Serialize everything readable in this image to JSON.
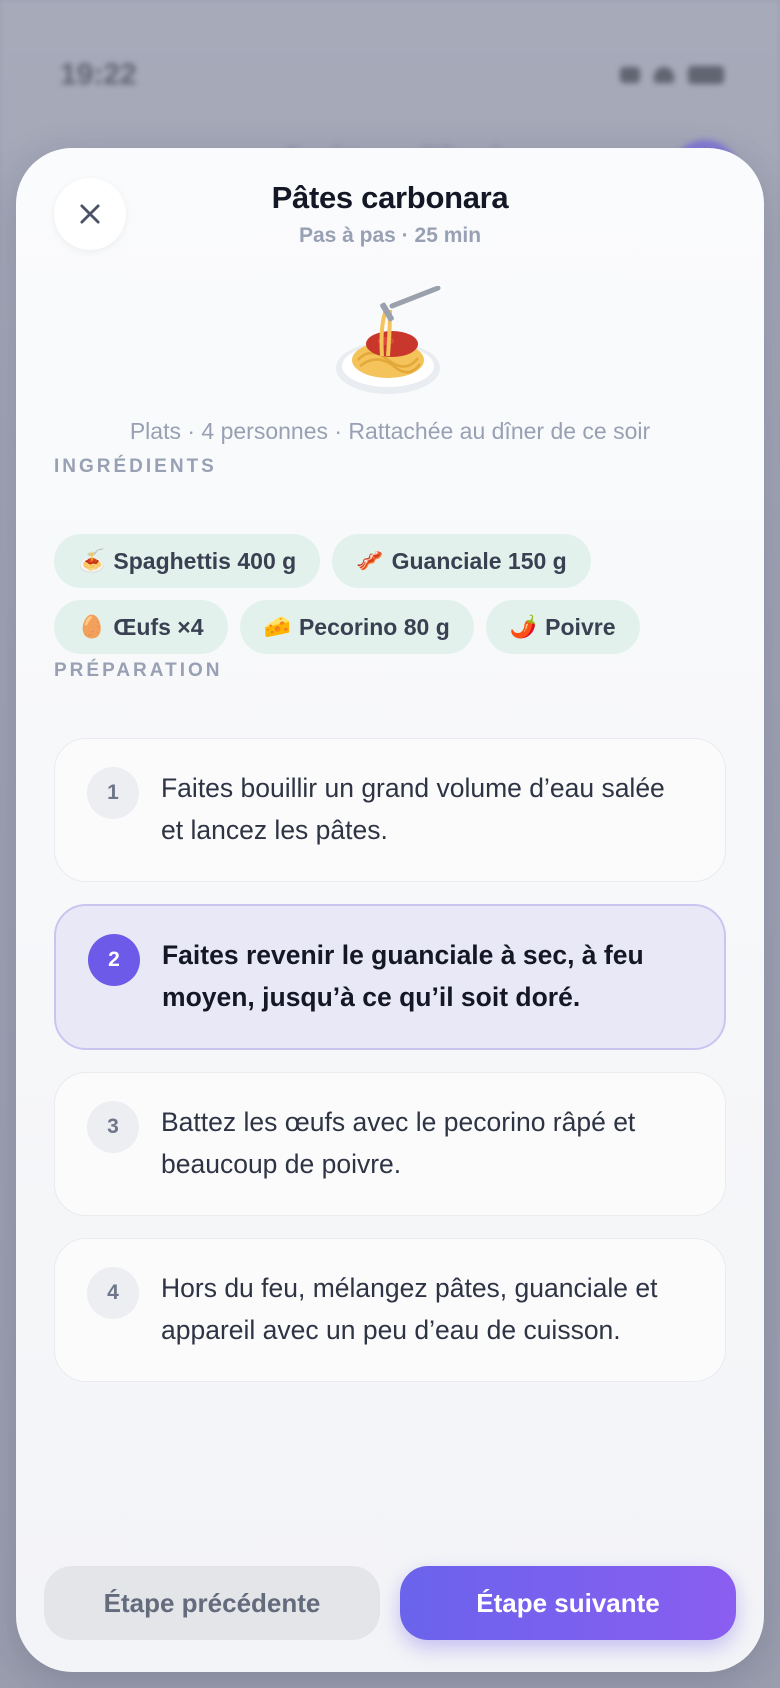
{
  "status_bar": {
    "time": "19:22"
  },
  "background": {
    "title": "Aujourd'hui"
  },
  "sheet": {
    "title": "Pâtes carbonara",
    "subtitle": "Pas à pas · 25 min",
    "hero_icon": "spaghetti-icon",
    "meta": "Plats · 4 personnes · Rattachée au dîner de ce soir",
    "ingredients_label": "INGRÉDIENTS",
    "ingredients": [
      {
        "emoji": "🍝",
        "label": "Spaghettis 400 g"
      },
      {
        "emoji": "🥓",
        "label": "Guanciale 150 g"
      },
      {
        "emoji": "🥚",
        "label": "Œufs ×4"
      },
      {
        "emoji": "🧀",
        "label": "Pecorino 80 g"
      },
      {
        "emoji": "🌶️",
        "label": "Poivre"
      }
    ],
    "preparation_label": "PRÉPARATION",
    "steps": [
      {
        "num": "1",
        "text": "Faites bouillir un grand volume d’eau salée et lancez les pâtes.",
        "active": false
      },
      {
        "num": "2",
        "text": "Faites revenir le guanciale à sec, à feu moyen, jusqu’à ce qu’il soit doré.",
        "active": true
      },
      {
        "num": "3",
        "text": "Battez les œufs avec le pecorino râpé et beaucoup de poivre.",
        "active": false
      },
      {
        "num": "4",
        "text": "Hors du feu, mélangez pâtes, guanciale et appareil avec un peu d’eau de cuisson.",
        "active": false
      }
    ],
    "prev_label": "Étape précédente",
    "next_label": "Étape suivante"
  },
  "colors": {
    "accent": "#6e5ae8",
    "chip_bg": "#e2f1ec",
    "active_step_bg": "#e9e8f7"
  }
}
